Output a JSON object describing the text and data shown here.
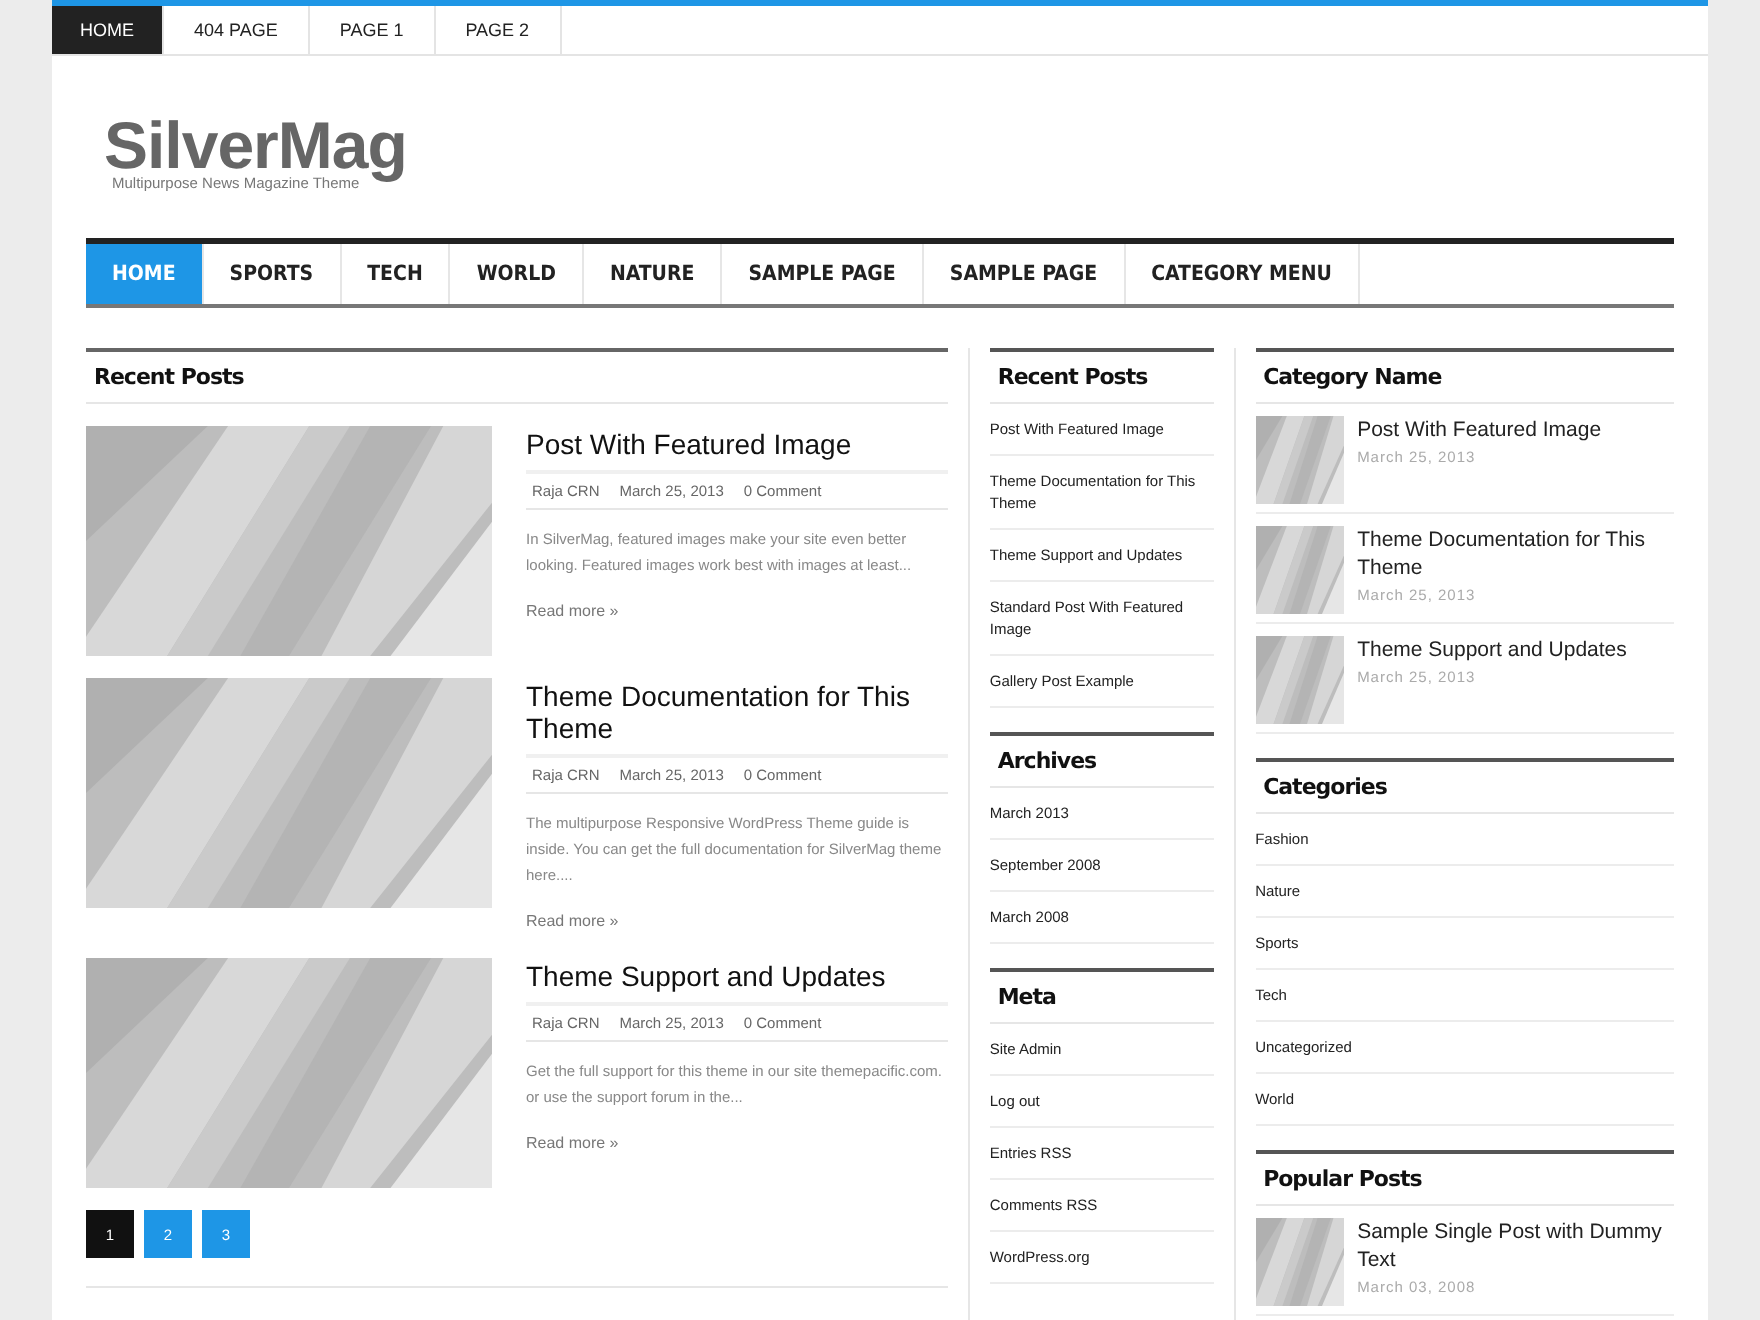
{
  "top_menu": [
    {
      "label": "HOME",
      "selected": true
    },
    {
      "label": "404 PAGE",
      "selected": false
    },
    {
      "label": "PAGE 1",
      "selected": false
    },
    {
      "label": "PAGE 2",
      "selected": false
    }
  ],
  "logo": {
    "title": "SilverMag",
    "tagline": "Multipurpose News Magazine Theme"
  },
  "main_nav": [
    {
      "label": "HOME",
      "selected": true
    },
    {
      "label": "SPORTS",
      "selected": false
    },
    {
      "label": "TECH",
      "selected": false
    },
    {
      "label": "WORLD",
      "selected": false
    },
    {
      "label": "NATURE",
      "selected": false
    },
    {
      "label": "SAMPLE PAGE",
      "selected": false
    },
    {
      "label": "SAMPLE PAGE",
      "selected": false
    },
    {
      "label": "CATEGORY MENU",
      "selected": false
    }
  ],
  "main": {
    "heading": "Recent Posts",
    "posts": [
      {
        "title": "Post With Featured Image",
        "author": "Raja CRN",
        "date": "March 25, 2013",
        "comments": "0 Comment",
        "excerpt": "In SilverMag, featured images make your site even better looking. Featured images work best with images at least...",
        "read_more": "Read more »"
      },
      {
        "title": "Theme Documentation for This Theme",
        "author": "Raja CRN",
        "date": "March 25, 2013",
        "comments": "0 Comment",
        "excerpt": "The multipurpose Responsive WordPress Theme guide is inside. You can get the full documentation for SilverMag theme here....",
        "read_more": "Read more »"
      },
      {
        "title": "Theme Support and Updates",
        "author": "Raja CRN",
        "date": "March 25, 2013",
        "comments": "0 Comment",
        "excerpt": "Get the full support for this theme in our site themepacific.com. or use the support forum in the...",
        "read_more": "Read more »"
      }
    ],
    "pagination": [
      {
        "label": "1",
        "selected": true
      },
      {
        "label": "2",
        "selected": false
      },
      {
        "label": "3",
        "selected": false
      }
    ]
  },
  "middle_sidebar": [
    {
      "kind": "links",
      "title": "Recent Posts",
      "items": [
        "Post With Featured Image",
        "Theme Documentation for This Theme",
        "Theme Support and Updates",
        "Standard Post With Featured Image",
        "Gallery Post Example"
      ]
    },
    {
      "kind": "links",
      "title": "Archives",
      "items": [
        "March 2013",
        "September 2008",
        "March 2008"
      ]
    },
    {
      "kind": "links",
      "title": "Meta",
      "items": [
        "Site Admin",
        "Log out",
        "Entries RSS",
        "Comments RSS",
        "WordPress.org"
      ]
    }
  ],
  "right_sidebar": [
    {
      "kind": "thumbs",
      "title": "Category Name",
      "posts": [
        {
          "title": "Post With Featured Image",
          "date": "March 25, 2013"
        },
        {
          "title": "Theme Documentation for This Theme",
          "date": "March 25, 2013"
        },
        {
          "title": "Theme Support and Updates",
          "date": "March 25, 2013"
        }
      ]
    },
    {
      "kind": "links",
      "title": "Categories",
      "items": [
        "Fashion",
        "Nature",
        "Sports",
        "Tech",
        "Uncategorized",
        "World"
      ]
    },
    {
      "kind": "thumbs",
      "title": "Popular Posts",
      "posts": [
        {
          "title": "Sample Single Post with Dummy Text",
          "date": "March 03, 2008"
        }
      ]
    }
  ]
}
